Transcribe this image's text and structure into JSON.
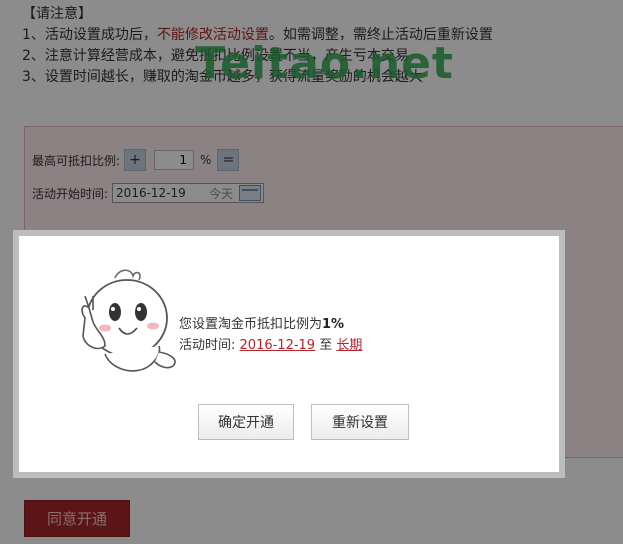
{
  "notice": {
    "heading": "【请注意】",
    "line1_prefix": "1、活动设置成功后，",
    "line1_highlight": "不能修改活动设置",
    "line1_suffix": "。如需调整，需终止活动后重新设置",
    "line2": "2、注意计算经营成本，避免抵扣比例设置不当，产生亏本交易",
    "line3": "3、设置时间越长，赚取的淘金币越多，获得流量奖励的机会越大"
  },
  "watermark": "Teitao.net",
  "form": {
    "max_ratio_label": "最高可抵扣比例:",
    "plus": "+",
    "ratio_value": "1",
    "percent": "%",
    "minus": "=",
    "start_time_label": "活动开始时间:",
    "start_date": "2016-12-19",
    "today_label": "今天"
  },
  "dialog": {
    "message_prefix": "您设置淘金币抵扣比例为",
    "ratio_text": "1%",
    "time_label": "活动时间:",
    "start_date": "2016-12-19",
    "to": "至",
    "end": "长期",
    "confirm_button": "确定开通",
    "reset_button": "重新设置"
  },
  "agree_button": "同意开通",
  "colors": {
    "accent": "#b3262b",
    "watermark": "#2fa84f"
  }
}
